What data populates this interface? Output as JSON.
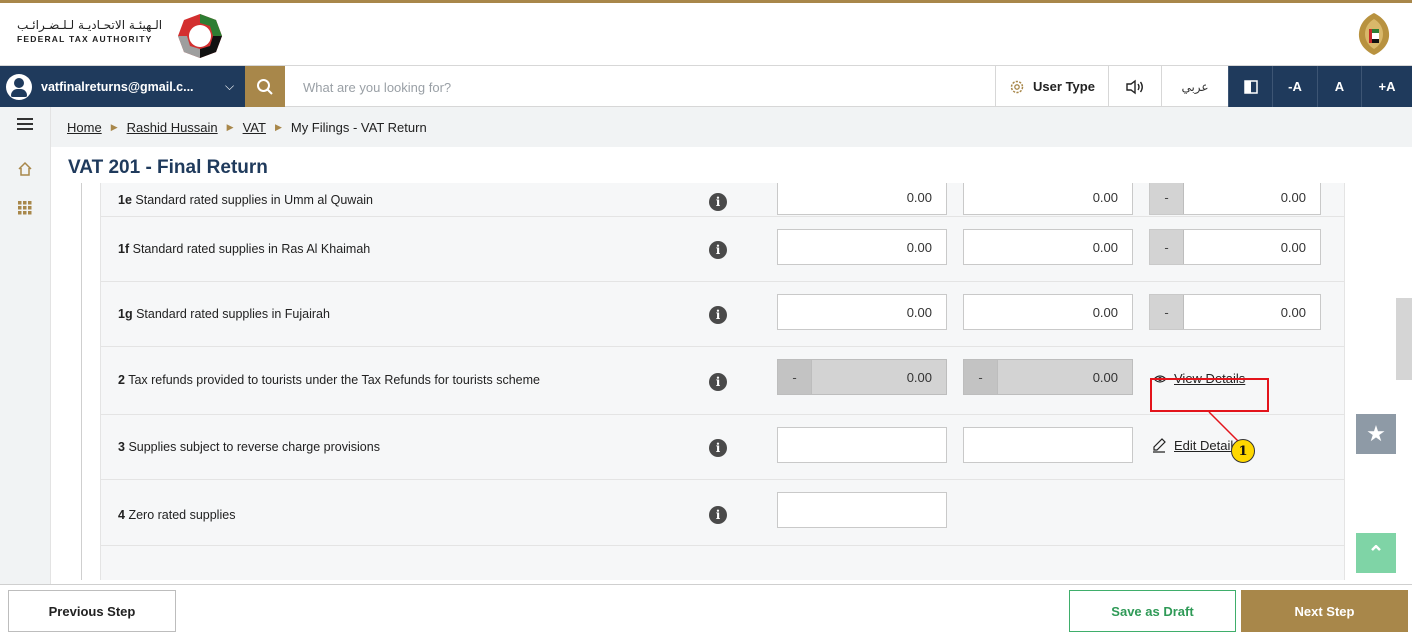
{
  "brand": {
    "name_ar": "الـهيئـة الاتحـاديـة لـلـضـرائـب",
    "name_en": "FEDERAL TAX AUTHORITY",
    "colors": {
      "navy": "#1f3a5c",
      "gold": "#a8874a",
      "green": "#3fae6b"
    }
  },
  "navbar": {
    "user_email": "vatfinalreturns@gmail.c...",
    "search_placeholder": "What are you looking for?",
    "user_type_label": "User Type",
    "arabic_label": "عربي",
    "font_minus": "-A",
    "font_normal": "A",
    "font_plus": "+A"
  },
  "breadcrumb": {
    "home": "Home",
    "user": "Rashid Hussain",
    "vat": "VAT",
    "current": "My Filings - VAT Return"
  },
  "page": {
    "title": "VAT 201 - Final Return"
  },
  "rows": [
    {
      "code": "1e",
      "label": "Standard rated supplies in Umm al Quwain",
      "amount": "0.00",
      "vat": "0.00",
      "adj_prefix": "-",
      "adj": "0.00"
    },
    {
      "code": "1f",
      "label": "Standard rated supplies in Ras Al Khaimah",
      "amount": "0.00",
      "vat": "0.00",
      "adj_prefix": "-",
      "adj": "0.00"
    },
    {
      "code": "1g",
      "label": "Standard rated supplies in Fujairah",
      "amount": "0.00",
      "vat": "0.00",
      "adj_prefix": "-",
      "adj": "0.00"
    },
    {
      "code": "2",
      "label": "Tax refunds provided to tourists under the Tax Refunds for tourists scheme",
      "amount_prefix": "-",
      "amount": "0.00",
      "vat_prefix": "-",
      "vat": "0.00",
      "action": "View Details"
    },
    {
      "code": "3",
      "label": "Supplies subject to reverse charge provisions",
      "amount": "",
      "vat": "",
      "action": "Edit Details"
    },
    {
      "code": "4",
      "label": "Zero rated supplies",
      "amount": ""
    }
  ],
  "annotation": {
    "number": "1"
  },
  "footer": {
    "previous": "Previous Step",
    "draft": "Save as Draft",
    "next": "Next Step"
  }
}
